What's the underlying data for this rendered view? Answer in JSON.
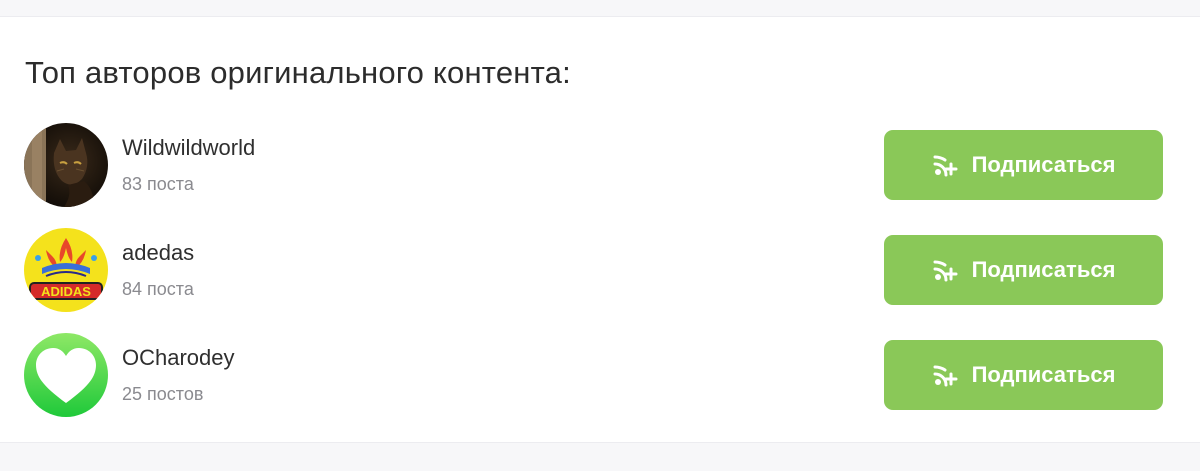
{
  "section": {
    "title": "Топ авторов оригинального контента:"
  },
  "authors": [
    {
      "name": "Wildwildworld",
      "posts": "83 поста",
      "subscribe_label": "Подписаться",
      "avatar_icon": "cat-photo-avatar"
    },
    {
      "name": "adedas",
      "posts": "84 поста",
      "subscribe_label": "Подписаться",
      "avatar_icon": "adidas-logo-avatar",
      "avatar_text": "ADIDAS"
    },
    {
      "name": "OCharodey",
      "posts": "25 постов",
      "subscribe_label": "Подписаться",
      "avatar_icon": "heart-avatar"
    }
  ],
  "colors": {
    "button": "#8ac858",
    "button_text": "#ffffff",
    "name_text": "#2f2f2f",
    "meta_text": "#8a8a8f"
  },
  "icons": {
    "subscribe": "rss-plus-icon"
  }
}
